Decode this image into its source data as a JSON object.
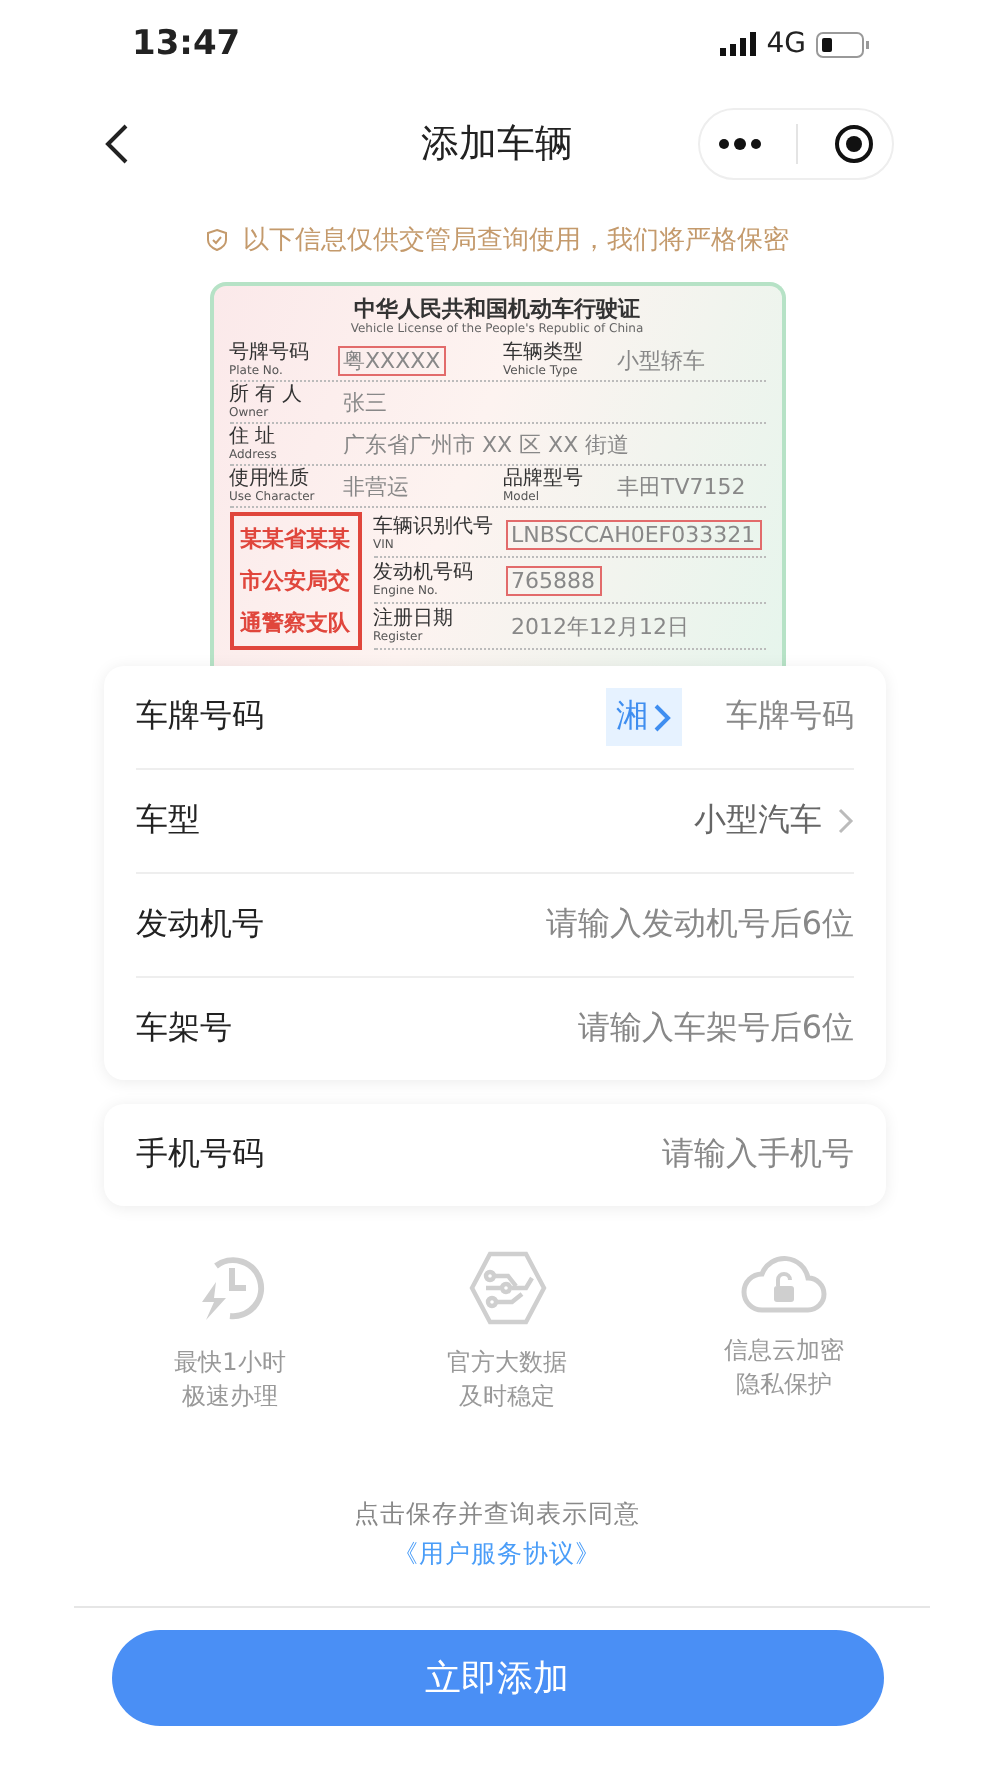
{
  "status_bar": {
    "time": "13:47",
    "network": "4G"
  },
  "nav": {
    "title": "添加车辆"
  },
  "notice": "以下信息仅供交管局查询使用，我们将严格保密",
  "license": {
    "title": "中华人民共和国机动车行驶证",
    "subtitle": "Vehicle License of the People's Republic of China",
    "rows": [
      [
        {
          "label": "号牌号码",
          "label_en": "Plate No.",
          "value": "粤XXXXX",
          "boxed": true
        },
        {
          "label": "车辆类型",
          "label_en": "Vehicle Type",
          "value": "小型轿车",
          "boxed": false
        }
      ],
      [
        {
          "label": "所 有 人",
          "label_en": "Owner",
          "value": "张三",
          "boxed": false
        }
      ],
      [
        {
          "label": "住 址",
          "label_en": "Address",
          "value": "广东省广州市 XX 区 XX 街道",
          "boxed": false
        }
      ],
      [
        {
          "label": "使用性质",
          "label_en": "Use Character",
          "value": "非营运",
          "boxed": false
        },
        {
          "label": "品牌型号",
          "label_en": "Model",
          "value": "丰田TV7152",
          "boxed": false
        }
      ]
    ],
    "stamp": [
      "某某省某某",
      "市公安局交",
      "通警察支队"
    ],
    "stamp_fields": [
      {
        "label": "车辆识别代号",
        "label_en": "VIN",
        "value": "LNBSCCAH0EF033321",
        "boxed": true
      },
      {
        "label": "发动机号码",
        "label_en": "Engine No.",
        "value": "765888",
        "boxed": true
      },
      {
        "label": "注册日期",
        "label_en": "Register",
        "value": "2012年12月12日",
        "boxed": false
      }
    ]
  },
  "form": {
    "rows": [
      {
        "kind": "plate",
        "label": "车牌号码",
        "prefix": "湘",
        "placeholder": "车牌号码"
      },
      {
        "kind": "select",
        "label": "车型",
        "value": "小型汽车"
      },
      {
        "kind": "input",
        "label": "发动机号",
        "placeholder": "请输入发动机号后6位"
      },
      {
        "kind": "input",
        "label": "车架号",
        "placeholder": "请输入车架号后6位"
      }
    ]
  },
  "phone": {
    "label": "手机号码",
    "placeholder": "请输入手机号"
  },
  "features": [
    {
      "kind": "speed",
      "lines": [
        "最快1小时",
        "极速办理"
      ]
    },
    {
      "kind": "data",
      "lines": [
        "官方大数据",
        "及时稳定"
      ]
    },
    {
      "kind": "secure",
      "lines": [
        "信息云加密",
        "隐私保护"
      ]
    }
  ],
  "agreement": {
    "text": "点击保存并查询表示同意",
    "link": "《用户服务协议》"
  },
  "submit": "立即添加"
}
